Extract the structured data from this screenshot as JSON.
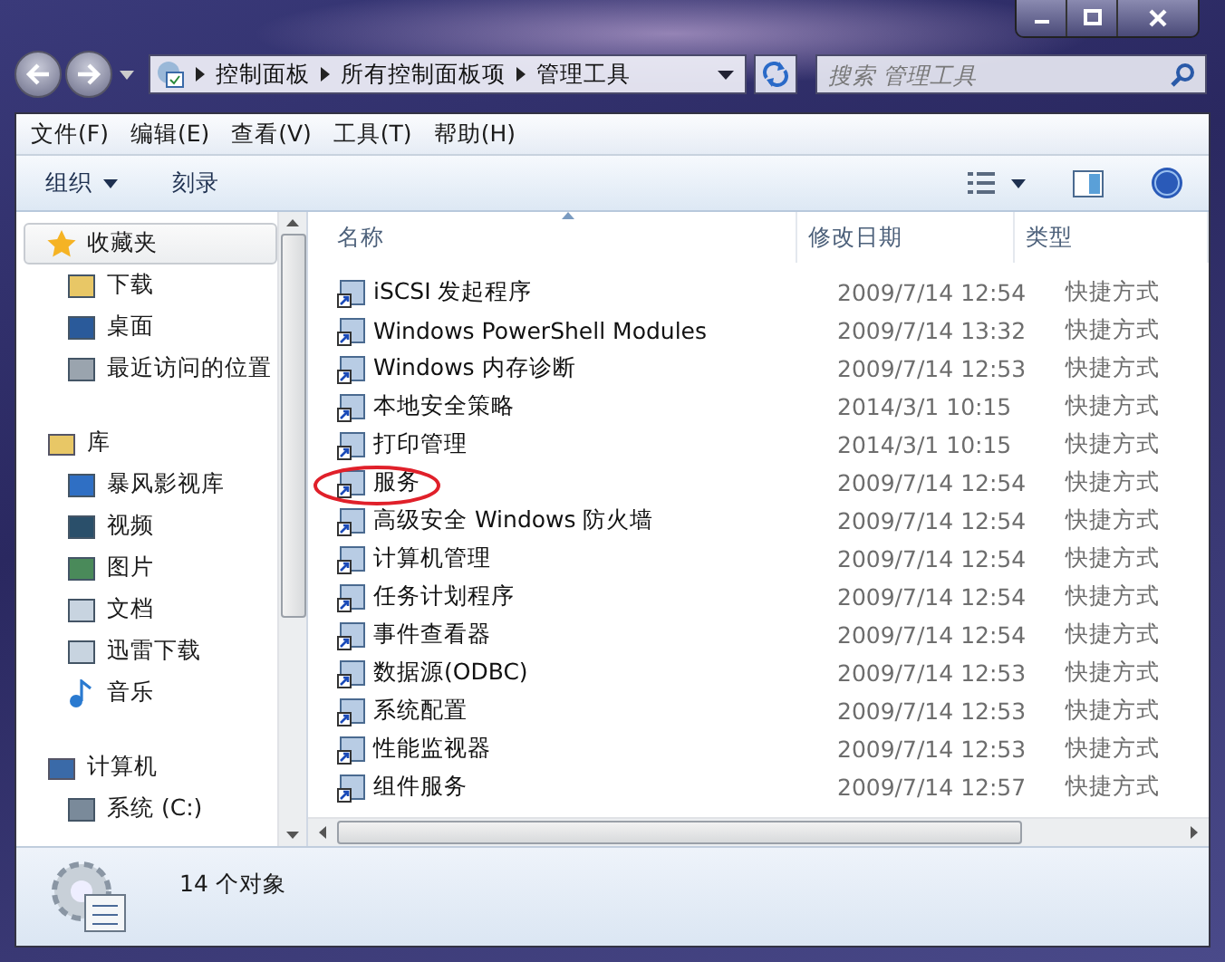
{
  "window": {
    "breadcrumb": [
      "控制面板",
      "所有控制面板项",
      "管理工具"
    ]
  },
  "search": {
    "placeholder": "搜索 管理工具"
  },
  "menu": [
    "文件(F)",
    "编辑(E)",
    "查看(V)",
    "工具(T)",
    "帮助(H)"
  ],
  "toolbar": [
    "组织",
    "刻录"
  ],
  "sidebar": {
    "sections": [
      {
        "label": "收藏夹",
        "selected": true,
        "items": [
          {
            "label": "下载"
          },
          {
            "label": "桌面"
          },
          {
            "label": "最近访问的位置"
          }
        ]
      },
      {
        "label": "库",
        "selected": false,
        "items": [
          {
            "label": "暴风影视库"
          },
          {
            "label": "视频"
          },
          {
            "label": "图片"
          },
          {
            "label": "文档"
          },
          {
            "label": "迅雷下载"
          },
          {
            "label": "音乐"
          }
        ]
      },
      {
        "label": "计算机",
        "selected": false,
        "items": [
          {
            "label": "系统 (C:)"
          }
        ]
      }
    ]
  },
  "table": {
    "columns": [
      "名称",
      "修改日期",
      "类型"
    ],
    "rows": [
      {
        "name": "iSCSI 发起程序",
        "date": "2009/7/14 12:54",
        "type": "快捷方式",
        "circled": false
      },
      {
        "name": "Windows PowerShell Modules",
        "date": "2009/7/14 13:32",
        "type": "快捷方式",
        "circled": false
      },
      {
        "name": "Windows 内存诊断",
        "date": "2009/7/14 12:53",
        "type": "快捷方式",
        "circled": false
      },
      {
        "name": "本地安全策略",
        "date": "2014/3/1 10:15",
        "type": "快捷方式",
        "circled": false
      },
      {
        "name": "打印管理",
        "date": "2014/3/1 10:15",
        "type": "快捷方式",
        "circled": false
      },
      {
        "name": "服务",
        "date": "2009/7/14 12:54",
        "type": "快捷方式",
        "circled": true
      },
      {
        "name": "高级安全 Windows 防火墙",
        "date": "2009/7/14 12:54",
        "type": "快捷方式",
        "circled": false
      },
      {
        "name": "计算机管理",
        "date": "2009/7/14 12:54",
        "type": "快捷方式",
        "circled": false
      },
      {
        "name": "任务计划程序",
        "date": "2009/7/14 12:54",
        "type": "快捷方式",
        "circled": false
      },
      {
        "name": "事件查看器",
        "date": "2009/7/14 12:54",
        "type": "快捷方式",
        "circled": false
      },
      {
        "name": "数据源(ODBC)",
        "date": "2009/7/14 12:53",
        "type": "快捷方式",
        "circled": false
      },
      {
        "name": "系统配置",
        "date": "2009/7/14 12:53",
        "type": "快捷方式",
        "circled": false
      },
      {
        "name": "性能监视器",
        "date": "2009/7/14 12:53",
        "type": "快捷方式",
        "circled": false
      },
      {
        "name": "组件服务",
        "date": "2009/7/14 12:57",
        "type": "快捷方式",
        "circled": false
      }
    ]
  },
  "status_bar": {
    "text": "14 个对象"
  }
}
